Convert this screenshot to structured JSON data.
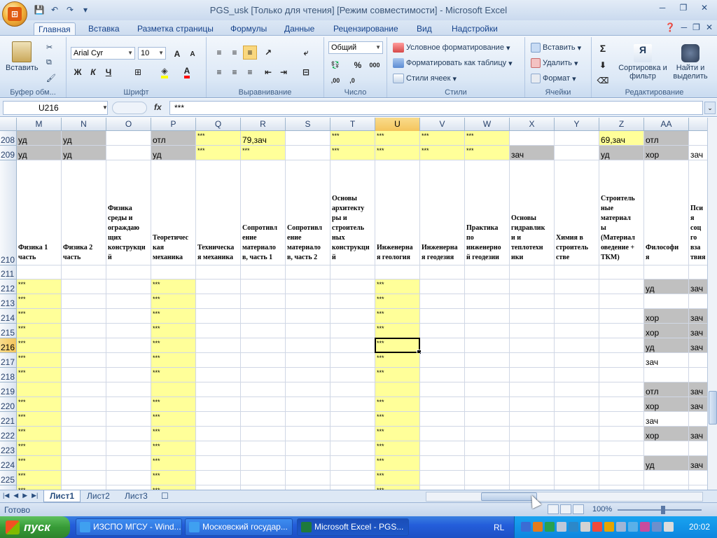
{
  "window": {
    "title": "PGS_usk  [Только для чтения]  [Режим совместимости] - Microsoft Excel"
  },
  "ribbon_tabs": [
    "Главная",
    "Вставка",
    "Разметка страницы",
    "Формулы",
    "Данные",
    "Рецензирование",
    "Вид",
    "Надстройки"
  ],
  "ribbon": {
    "clipboard": {
      "paste": "Вставить",
      "label": "Буфер обм..."
    },
    "font": {
      "name": "Arial Cyr",
      "size": "10",
      "bold": "Ж",
      "italic": "К",
      "underline": "Ч",
      "label": "Шрифт"
    },
    "alignment": {
      "label": "Выравнивание"
    },
    "number": {
      "format": "Общий",
      "label": "Число"
    },
    "styles": {
      "conditional": "Условное форматирование",
      "as_table": "Форматировать как таблицу",
      "cell_styles": "Стили ячеек",
      "label": "Стили"
    },
    "cells": {
      "insert": "Вставить",
      "delete": "Удалить",
      "format": "Формат",
      "label": "Ячейки"
    },
    "editing": {
      "sort": "Сортировка и фильтр",
      "find": "Найти и выделить",
      "label": "Редактирование"
    }
  },
  "formula_bar": {
    "name_box": "U216",
    "fx": "fx",
    "value": "***"
  },
  "grid": {
    "columns": [
      "M",
      "N",
      "O",
      "P",
      "Q",
      "R",
      "S",
      "T",
      "U",
      "V",
      "W",
      "X",
      "Y",
      "Z",
      "AA"
    ],
    "selected_column": "U",
    "selected_row": "216",
    "rows": [
      {
        "num": "208",
        "cells": [
          "уд",
          "уд",
          "",
          "отл",
          "***",
          "79,зач",
          "",
          "***",
          "***",
          "***",
          "***",
          "",
          "",
          "69,зач",
          "отл",
          ""
        ]
      },
      {
        "num": "209",
        "cells": [
          "уд",
          "уд",
          "",
          "уд",
          "***",
          "***",
          "",
          "***",
          "***",
          "***",
          "***",
          "зач",
          "",
          "уд",
          "хор",
          "зач"
        ]
      },
      {
        "num": "210",
        "headers": [
          "Физика 1\nчасть",
          "Физика 2\nчасть",
          "Физика\nсреды и\nограждаю\nщих\nконструкци\nй",
          "Теоретичес\nкая\nмеханика",
          "Техническа\nя механика",
          "Сопротивл\nение\nматериало\nв, часть 1",
          "Сопротивл\nение\nматериало\nв, часть 2",
          "Основы\nархитекту\nры и\nстроитель\nных\nконструкци\nй",
          "Инженерна\nя геология",
          "Инженерна\nя геодезия",
          "Практика\nпо\nинженерно\nй геодезии",
          "Основы\nгидравлик\nи и\nтеплотехн\nики",
          "Химия в\nстроитель\nстве",
          "Строитель\nные\nматериал\nы\n(Материал\nоведение +\nТКМ)",
          "Философи\nя",
          "Пси\nя\nсоц\nго\nвза\nтвия"
        ]
      },
      {
        "num": "211",
        "cells": []
      },
      {
        "num": "212",
        "cells": [
          "***",
          "",
          "",
          "***",
          "",
          "",
          "",
          "",
          "***",
          "",
          "",
          "",
          "",
          "",
          "уд",
          "зач"
        ]
      },
      {
        "num": "213",
        "cells": [
          "***",
          "",
          "",
          "***",
          "",
          "",
          "",
          "",
          "***",
          "",
          "",
          "",
          "",
          "",
          "",
          ""
        ]
      },
      {
        "num": "214",
        "cells": [
          "***",
          "",
          "",
          "***",
          "",
          "",
          "",
          "",
          "***",
          "",
          "",
          "",
          "",
          "",
          "хор",
          "зач"
        ]
      },
      {
        "num": "215",
        "cells": [
          "***",
          "",
          "",
          "***",
          "",
          "",
          "",
          "",
          "***",
          "",
          "",
          "",
          "",
          "",
          "хор",
          "зач"
        ]
      },
      {
        "num": "216",
        "cells": [
          "***",
          "",
          "",
          "***",
          "",
          "",
          "",
          "",
          "***",
          "",
          "",
          "",
          "",
          "",
          "уд",
          "зач"
        ]
      },
      {
        "num": "217",
        "cells": [
          "***",
          "",
          "",
          "***",
          "",
          "",
          "",
          "",
          "***",
          "",
          "",
          "",
          "",
          "",
          "зач",
          ""
        ]
      },
      {
        "num": "218",
        "cells": [
          "***",
          "",
          "",
          "***",
          "",
          "",
          "",
          "",
          "***",
          "",
          "",
          "",
          "",
          "",
          "",
          ""
        ]
      },
      {
        "num": "219",
        "cells": [
          "",
          "",
          "",
          "",
          "",
          "",
          "",
          "",
          "",
          "",
          "",
          "",
          "",
          "",
          "отл",
          "зач"
        ]
      },
      {
        "num": "220",
        "cells": [
          "***",
          "",
          "",
          "***",
          "",
          "",
          "",
          "",
          "***",
          "",
          "",
          "",
          "",
          "",
          "хор",
          "зач"
        ]
      },
      {
        "num": "221",
        "cells": [
          "***",
          "",
          "",
          "***",
          "",
          "",
          "",
          "",
          "***",
          "",
          "",
          "",
          "",
          "",
          "зач",
          ""
        ]
      },
      {
        "num": "222",
        "cells": [
          "***",
          "",
          "",
          "***",
          "",
          "",
          "",
          "",
          "***",
          "",
          "",
          "",
          "",
          "",
          "хор",
          "зач"
        ]
      },
      {
        "num": "223",
        "cells": [
          "***",
          "",
          "",
          "***",
          "",
          "",
          "",
          "",
          "***",
          "",
          "",
          "",
          "",
          "",
          "",
          ""
        ]
      },
      {
        "num": "224",
        "cells": [
          "***",
          "",
          "",
          "***",
          "",
          "",
          "",
          "",
          "***",
          "",
          "",
          "",
          "",
          "",
          "уд",
          "зач"
        ]
      },
      {
        "num": "225",
        "cells": [
          "***",
          "",
          "",
          "***",
          "",
          "",
          "",
          "",
          "***",
          "",
          "",
          "",
          "",
          "",
          "",
          ""
        ]
      },
      {
        "num": "226",
        "cells": [
          "***",
          "",
          "",
          "***",
          "",
          "",
          "",
          "",
          "***",
          "",
          "",
          "",
          "",
          "",
          "",
          ""
        ]
      }
    ]
  },
  "sheets": [
    "Лист1",
    "Лист2",
    "Лист3"
  ],
  "status": {
    "text": "Готово",
    "zoom": "100%"
  },
  "taskbar": {
    "start": "пуск",
    "tasks": [
      "ИЗСПО МГСУ - Wind...",
      "Московский государ...",
      "Microsoft Excel - PGS..."
    ],
    "lang": "RL",
    "clock": "20:02"
  },
  "colors": {
    "yellow_fill": "#ffff99",
    "grey_fill": "#c0c0c0",
    "ribbon_blue": "#dce8f6",
    "taskbar_blue": "#245edb",
    "start_green": "#379b37"
  }
}
